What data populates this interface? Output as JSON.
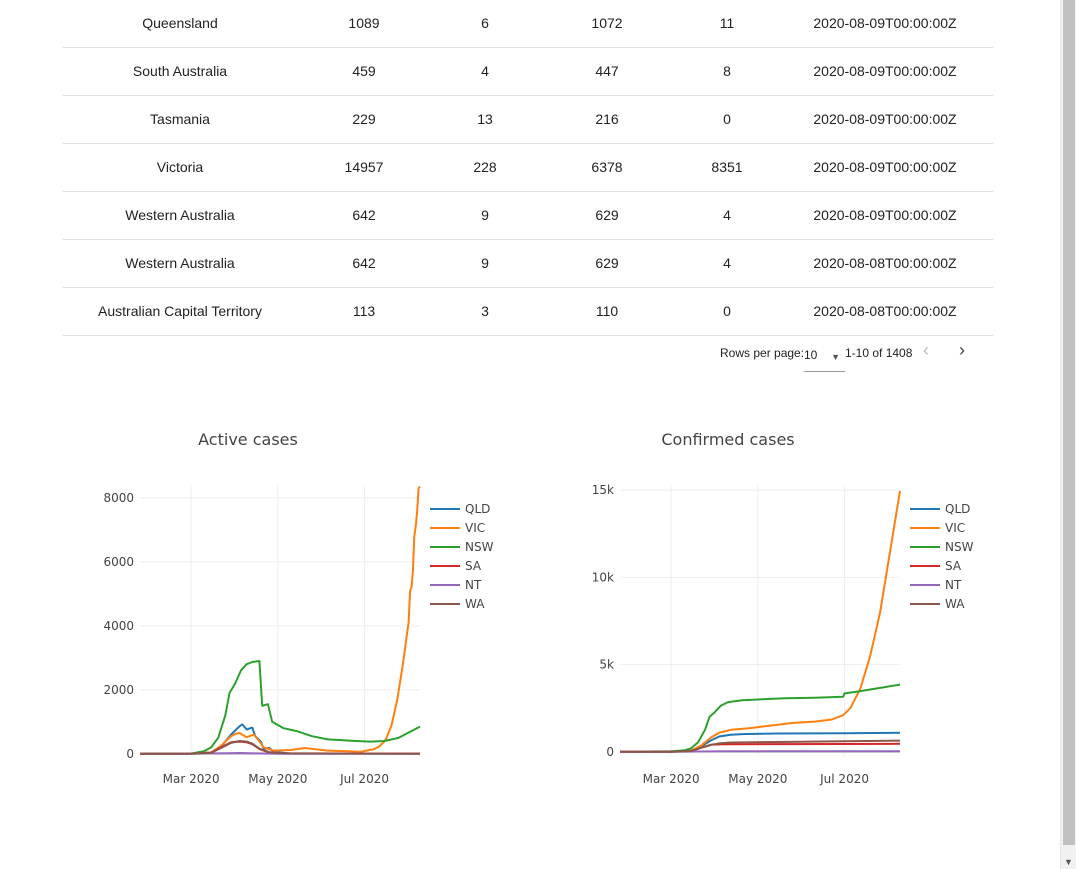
{
  "table": {
    "rows": [
      [
        "Queensland",
        "1089",
        "6",
        "1072",
        "11",
        "2020-08-09T00:00:00Z"
      ],
      [
        "South Australia",
        "459",
        "4",
        "447",
        "8",
        "2020-08-09T00:00:00Z"
      ],
      [
        "Tasmania",
        "229",
        "13",
        "216",
        "0",
        "2020-08-09T00:00:00Z"
      ],
      [
        "Victoria",
        "14957",
        "228",
        "6378",
        "8351",
        "2020-08-09T00:00:00Z"
      ],
      [
        "Western Australia",
        "642",
        "9",
        "629",
        "4",
        "2020-08-09T00:00:00Z"
      ],
      [
        "Western Australia",
        "642",
        "9",
        "629",
        "4",
        "2020-08-08T00:00:00Z"
      ],
      [
        "Australian Capital Territory",
        "113",
        "3",
        "110",
        "0",
        "2020-08-08T00:00:00Z"
      ]
    ]
  },
  "pagination": {
    "rows_per_page_label": "Rows per page:",
    "rows_per_page_value": "10",
    "range_text": "1-10 of 1408",
    "prev_icon": "chevron-left-icon",
    "next_icon": "chevron-right-icon"
  },
  "colors": {
    "QLD": "#1f77b4",
    "VIC": "#ff7f0e",
    "NSW": "#2ca02c",
    "SA": "#d62728",
    "NT": "#9467bd",
    "WA": "#8c564b"
  },
  "chart_data": [
    {
      "type": "line",
      "title": "Active cases",
      "x_tick_labels": [
        "Mar 2020",
        "May 2020",
        "Jul 2020"
      ],
      "x_ticks": [
        "2020-03-01",
        "2020-05-01",
        "2020-07-01"
      ],
      "xlim": [
        "2020-01-25",
        "2020-08-09"
      ],
      "y_tick_labels": [
        "0",
        "2000",
        "4000",
        "6000",
        "8000"
      ],
      "y_ticks": [
        0,
        2000,
        4000,
        6000,
        8000
      ],
      "ylim": [
        -100,
        8400
      ],
      "grid": true,
      "legend_position": "right",
      "series": [
        {
          "name": "QLD",
          "points": [
            [
              "2020-01-25",
              0
            ],
            [
              "2020-03-01",
              5
            ],
            [
              "2020-03-15",
              40
            ],
            [
              "2020-03-22",
              220
            ],
            [
              "2020-03-29",
              600
            ],
            [
              "2020-04-04",
              860
            ],
            [
              "2020-04-06",
              920
            ],
            [
              "2020-04-09",
              760
            ],
            [
              "2020-04-13",
              820
            ],
            [
              "2020-04-15",
              560
            ],
            [
              "2020-04-19",
              380
            ],
            [
              "2020-04-21",
              160
            ],
            [
              "2020-04-25",
              180
            ],
            [
              "2020-04-28",
              60
            ],
            [
              "2020-05-10",
              10
            ],
            [
              "2020-08-09",
              5
            ]
          ]
        },
        {
          "name": "VIC",
          "points": [
            [
              "2020-01-25",
              0
            ],
            [
              "2020-03-01",
              5
            ],
            [
              "2020-03-15",
              40
            ],
            [
              "2020-03-22",
              250
            ],
            [
              "2020-03-29",
              550
            ],
            [
              "2020-04-01",
              620
            ],
            [
              "2020-04-04",
              650
            ],
            [
              "2020-04-09",
              520
            ],
            [
              "2020-04-14",
              600
            ],
            [
              "2020-04-17",
              450
            ],
            [
              "2020-04-21",
              200
            ],
            [
              "2020-04-28",
              100
            ],
            [
              "2020-05-10",
              120
            ],
            [
              "2020-05-20",
              180
            ],
            [
              "2020-06-05",
              100
            ],
            [
              "2020-06-20",
              80
            ],
            [
              "2020-06-28",
              60
            ],
            [
              "2020-07-08",
              150
            ],
            [
              "2020-07-12",
              250
            ],
            [
              "2020-07-16",
              450
            ],
            [
              "2020-07-20",
              900
            ],
            [
              "2020-07-24",
              1700
            ],
            [
              "2020-07-28",
              2800
            ],
            [
              "2020-07-31",
              3800
            ],
            [
              "2020-08-01",
              4100
            ],
            [
              "2020-08-02",
              5100
            ],
            [
              "2020-08-03",
              5200
            ],
            [
              "2020-08-04",
              5700
            ],
            [
              "2020-08-05",
              6800
            ],
            [
              "2020-08-06",
              7100
            ],
            [
              "2020-08-07",
              7600
            ],
            [
              "2020-08-08",
              8300
            ],
            [
              "2020-08-09",
              8351
            ]
          ]
        },
        {
          "name": "NSW",
          "points": [
            [
              "2020-01-25",
              0
            ],
            [
              "2020-03-01",
              10
            ],
            [
              "2020-03-10",
              80
            ],
            [
              "2020-03-15",
              200
            ],
            [
              "2020-03-20",
              500
            ],
            [
              "2020-03-25",
              1200
            ],
            [
              "2020-03-28",
              1900
            ],
            [
              "2020-04-01",
              2200
            ],
            [
              "2020-04-05",
              2600
            ],
            [
              "2020-04-09",
              2800
            ],
            [
              "2020-04-13",
              2870
            ],
            [
              "2020-04-18",
              2900
            ],
            [
              "2020-04-20",
              1500
            ],
            [
              "2020-04-24",
              1550
            ],
            [
              "2020-04-27",
              1000
            ],
            [
              "2020-05-05",
              800
            ],
            [
              "2020-05-15",
              700
            ],
            [
              "2020-05-25",
              550
            ],
            [
              "2020-06-05",
              450
            ],
            [
              "2020-06-25",
              400
            ],
            [
              "2020-07-05",
              380
            ],
            [
              "2020-07-15",
              400
            ],
            [
              "2020-07-25",
              500
            ],
            [
              "2020-08-09",
              850
            ]
          ]
        },
        {
          "name": "SA",
          "points": [
            [
              "2020-01-25",
              0
            ],
            [
              "2020-03-01",
              2
            ],
            [
              "2020-03-15",
              30
            ],
            [
              "2020-03-22",
              200
            ],
            [
              "2020-03-29",
              360
            ],
            [
              "2020-04-04",
              380
            ],
            [
              "2020-04-09",
              360
            ],
            [
              "2020-04-13",
              300
            ],
            [
              "2020-04-18",
              150
            ],
            [
              "2020-04-25",
              40
            ],
            [
              "2020-05-05",
              10
            ],
            [
              "2020-08-09",
              8
            ]
          ]
        },
        {
          "name": "NT",
          "points": [
            [
              "2020-01-25",
              0
            ],
            [
              "2020-03-01",
              0
            ],
            [
              "2020-03-25",
              15
            ],
            [
              "2020-04-05",
              25
            ],
            [
              "2020-04-20",
              10
            ],
            [
              "2020-05-01",
              2
            ],
            [
              "2020-08-09",
              0
            ]
          ]
        },
        {
          "name": "WA",
          "points": [
            [
              "2020-01-25",
              0
            ],
            [
              "2020-03-01",
              2
            ],
            [
              "2020-03-15",
              30
            ],
            [
              "2020-03-22",
              180
            ],
            [
              "2020-03-29",
              340
            ],
            [
              "2020-04-04",
              400
            ],
            [
              "2020-04-09",
              380
            ],
            [
              "2020-04-13",
              320
            ],
            [
              "2020-04-18",
              160
            ],
            [
              "2020-04-25",
              50
            ],
            [
              "2020-05-05",
              15
            ],
            [
              "2020-08-09",
              4
            ]
          ]
        }
      ]
    },
    {
      "type": "line",
      "title": "Confirmed cases",
      "x_tick_labels": [
        "Mar 2020",
        "May 2020",
        "Jul 2020"
      ],
      "x_ticks": [
        "2020-03-01",
        "2020-05-01",
        "2020-07-01"
      ],
      "xlim": [
        "2020-01-25",
        "2020-08-09"
      ],
      "y_tick_labels": [
        "0",
        "5k",
        "10k",
        "15k"
      ],
      "y_ticks": [
        0,
        5000,
        10000,
        15000
      ],
      "ylim": [
        -300,
        15300
      ],
      "grid": true,
      "legend_position": "right",
      "series": [
        {
          "name": "QLD",
          "points": [
            [
              "2020-01-25",
              0
            ],
            [
              "2020-03-01",
              10
            ],
            [
              "2020-03-15",
              70
            ],
            [
              "2020-03-22",
              300
            ],
            [
              "2020-03-29",
              650
            ],
            [
              "2020-04-04",
              880
            ],
            [
              "2020-04-12",
              980
            ],
            [
              "2020-04-22",
              1020
            ],
            [
              "2020-05-15",
              1050
            ],
            [
              "2020-07-01",
              1067
            ],
            [
              "2020-08-09",
              1089
            ]
          ]
        },
        {
          "name": "VIC",
          "points": [
            [
              "2020-01-25",
              0
            ],
            [
              "2020-03-01",
              10
            ],
            [
              "2020-03-15",
              60
            ],
            [
              "2020-03-22",
              350
            ],
            [
              "2020-03-29",
              820
            ],
            [
              "2020-04-04",
              1100
            ],
            [
              "2020-04-12",
              1260
            ],
            [
              "2020-04-25",
              1350
            ],
            [
              "2020-05-10",
              1500
            ],
            [
              "2020-05-25",
              1650
            ],
            [
              "2020-06-10",
              1730
            ],
            [
              "2020-06-22",
              1850
            ],
            [
              "2020-06-30",
              2100
            ],
            [
              "2020-07-05",
              2500
            ],
            [
              "2020-07-12",
              3600
            ],
            [
              "2020-07-19",
              5500
            ],
            [
              "2020-07-26",
              8000
            ],
            [
              "2020-08-02",
              11500
            ],
            [
              "2020-08-09",
              14957
            ]
          ]
        },
        {
          "name": "NSW",
          "points": [
            [
              "2020-01-25",
              0
            ],
            [
              "2020-03-01",
              25
            ],
            [
              "2020-03-10",
              80
            ],
            [
              "2020-03-15",
              200
            ],
            [
              "2020-03-20",
              550
            ],
            [
              "2020-03-25",
              1300
            ],
            [
              "2020-03-28",
              2000
            ],
            [
              "2020-04-01",
              2300
            ],
            [
              "2020-04-05",
              2650
            ],
            [
              "2020-04-10",
              2850
            ],
            [
              "2020-04-20",
              2950
            ],
            [
              "2020-05-01",
              3000
            ],
            [
              "2020-05-20",
              3070
            ],
            [
              "2020-06-10",
              3100
            ],
            [
              "2020-06-30",
              3150
            ],
            [
              "2020-07-01",
              3350
            ],
            [
              "2020-07-10",
              3450
            ],
            [
              "2020-07-25",
              3650
            ],
            [
              "2020-08-09",
              3850
            ]
          ]
        },
        {
          "name": "SA",
          "points": [
            [
              "2020-01-25",
              0
            ],
            [
              "2020-03-01",
              2
            ],
            [
              "2020-03-15",
              30
            ],
            [
              "2020-03-22",
              230
            ],
            [
              "2020-03-29",
              400
            ],
            [
              "2020-04-04",
              420
            ],
            [
              "2020-04-12",
              435
            ],
            [
              "2020-05-15",
              440
            ],
            [
              "2020-07-01",
              445
            ],
            [
              "2020-08-09",
              459
            ]
          ]
        },
        {
          "name": "NT",
          "points": [
            [
              "2020-01-25",
              0
            ],
            [
              "2020-03-01",
              0
            ],
            [
              "2020-03-22",
              15
            ],
            [
              "2020-04-05",
              28
            ],
            [
              "2020-07-01",
              30
            ],
            [
              "2020-08-09",
              33
            ]
          ]
        },
        {
          "name": "WA",
          "points": [
            [
              "2020-01-25",
              0
            ],
            [
              "2020-03-01",
              2
            ],
            [
              "2020-03-15",
              40
            ],
            [
              "2020-03-22",
              230
            ],
            [
              "2020-03-29",
              400
            ],
            [
              "2020-04-04",
              480
            ],
            [
              "2020-04-12",
              530
            ],
            [
              "2020-05-15",
              560
            ],
            [
              "2020-07-01",
              600
            ],
            [
              "2020-08-09",
              642
            ]
          ]
        }
      ]
    }
  ]
}
